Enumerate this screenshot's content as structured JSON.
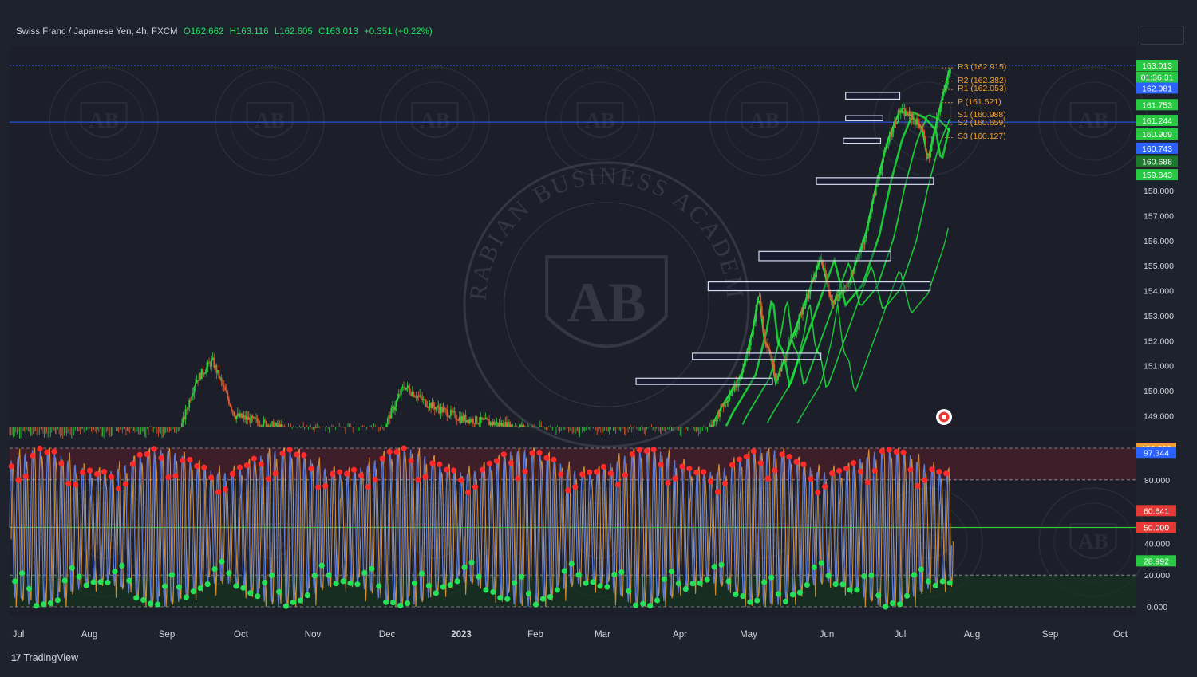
{
  "header": {
    "symbol": "Swiss Franc / Japanese Yen, 4h, FXCM",
    "open": "O162.662",
    "high": "H163.116",
    "low": "L162.605",
    "close": "C163.013",
    "change": "+0.351 (+0.22%)"
  },
  "brand": {
    "name": "TradingView",
    "logo": "17"
  },
  "watermark": {
    "top_text": "ARABIAN BUSINESS ACADEMY",
    "monogram": "AB"
  },
  "colors": {
    "background": "#1e222d",
    "up_candle": "#2ecc40",
    "down_candle": "#e05a30",
    "ema": "#1aff3c",
    "oscillator_line": "#5b7bd5",
    "oscillator_signal": "#f0a030",
    "overbought_zone": "#4a1f2a",
    "oversold_zone": "#16331f",
    "pivot_text": "#f0a030",
    "horizontal_line": "#2962ff",
    "oscillator_midline": "#37c837"
  },
  "chart_data": [
    {
      "type": "candlestick",
      "title": "Swiss Franc / Japanese Yen, 4h, FXCM",
      "ylim": [
        148.5,
        164.8
      ],
      "y_ticks": [
        "158.000",
        "157.000",
        "156.000",
        "155.000",
        "154.000",
        "153.000",
        "152.000",
        "151.000",
        "150.000",
        "149.000"
      ],
      "x_ticks": [
        "Jul",
        "Aug",
        "Sep",
        "Oct",
        "Nov",
        "Dec",
        "2023",
        "Feb",
        "Mar",
        "Apr",
        "May",
        "Jun",
        "Jul",
        "Aug",
        "Sep",
        "Oct"
      ],
      "price_path": [
        [
          0.0,
          148.1
        ],
        [
          0.15,
          148.2
        ],
        [
          0.165,
          150.4
        ],
        [
          0.18,
          151.2
        ],
        [
          0.2,
          149.0
        ],
        [
          0.25,
          148.4
        ],
        [
          0.33,
          148.3
        ],
        [
          0.35,
          150.2
        ],
        [
          0.37,
          149.5
        ],
        [
          0.4,
          148.9
        ],
        [
          0.5,
          148.2
        ],
        [
          0.62,
          148.3
        ],
        [
          0.63,
          149.2
        ],
        [
          0.65,
          150.7
        ],
        [
          0.66,
          152.5
        ],
        [
          0.665,
          153.9
        ],
        [
          0.67,
          152.0
        ],
        [
          0.675,
          151.6
        ],
        [
          0.68,
          150.3
        ],
        [
          0.7,
          152.8
        ],
        [
          0.72,
          155.3
        ],
        [
          0.73,
          153.5
        ],
        [
          0.745,
          154.3
        ],
        [
          0.76,
          156.3
        ],
        [
          0.77,
          158.4
        ],
        [
          0.78,
          160.1
        ],
        [
          0.79,
          161.2
        ],
        [
          0.8,
          161.0
        ],
        [
          0.81,
          160.5
        ],
        [
          0.815,
          159.2
        ],
        [
          0.825,
          161.2
        ],
        [
          0.835,
          163.013
        ]
      ],
      "pivots": [
        {
          "label": "R3 (162.915)",
          "value": 162.915
        },
        {
          "label": "R2 (162.382)",
          "value": 162.382
        },
        {
          "label": "R1 (162.053)",
          "value": 162.053
        },
        {
          "label": "P (161.521)",
          "value": 161.521
        },
        {
          "label": "S1 (160.988)",
          "value": 160.988
        },
        {
          "label": "S2 (160.659)",
          "value": 160.659
        },
        {
          "label": "S3 (160.127)",
          "value": 160.127
        }
      ],
      "price_labels": [
        {
          "text": "163.013",
          "value": 163.013,
          "color": "#26c940"
        },
        {
          "text": "01:36:31",
          "value": 162.55,
          "color": "#26c940"
        },
        {
          "text": "162.981",
          "value": 162.105,
          "color": "#2962ff"
        },
        {
          "text": "161.753",
          "value": 161.44,
          "color": "#26c940"
        },
        {
          "text": "161.244",
          "value": 160.81,
          "color": "#26c940"
        },
        {
          "text": "160.909",
          "value": 160.27,
          "color": "#26c940"
        },
        {
          "text": "160.743",
          "value": 159.7,
          "color": "#2962ff"
        },
        {
          "text": "160.688",
          "value": 159.17,
          "color": "#1b7a2c"
        },
        {
          "text": "159.843",
          "value": 158.64,
          "color": "#26c940"
        }
      ],
      "zones": [
        {
          "x_start": 0.716,
          "x_end": 0.82,
          "y_low": 158.25,
          "y_high": 158.52
        },
        {
          "x_start": 0.665,
          "x_end": 0.782,
          "y_low": 155.2,
          "y_high": 155.57
        },
        {
          "x_start": 0.62,
          "x_end": 0.817,
          "y_low": 154.0,
          "y_high": 154.35
        },
        {
          "x_start": 0.606,
          "x_end": 0.72,
          "y_low": 151.25,
          "y_high": 151.5
        },
        {
          "x_start": 0.556,
          "x_end": 0.677,
          "y_low": 150.25,
          "y_high": 150.5
        },
        {
          "x_start": 0.742,
          "x_end": 0.79,
          "y_low": 161.66,
          "y_high": 161.93
        },
        {
          "x_start": 0.742,
          "x_end": 0.775,
          "y_low": 160.8,
          "y_high": 161.0
        },
        {
          "x_start": 0.74,
          "x_end": 0.773,
          "y_low": 159.9,
          "y_high": 160.1
        }
      ],
      "horizontal_lines": [
        163.013,
        160.743
      ]
    },
    {
      "type": "line",
      "title": "",
      "ylim": [
        -5,
        105
      ],
      "y_ticks": [
        "80.000",
        "40.000",
        "20.000",
        "0.000"
      ],
      "levels": {
        "overbought": 80,
        "midline": 50,
        "oversold": 20
      },
      "cycles": 132,
      "value_labels": [
        {
          "text": "100.000",
          "value": 100,
          "color": "#f0a030"
        },
        {
          "text": "97.344",
          "value": 97.344,
          "color": "#2962ff"
        },
        {
          "text": "60.641",
          "value": 60.641,
          "color": "#e53935"
        },
        {
          "text": "50.000",
          "value": 50,
          "color": "#e53935"
        },
        {
          "text": "28.992",
          "value": 28.992,
          "color": "#26c940"
        }
      ]
    }
  ]
}
